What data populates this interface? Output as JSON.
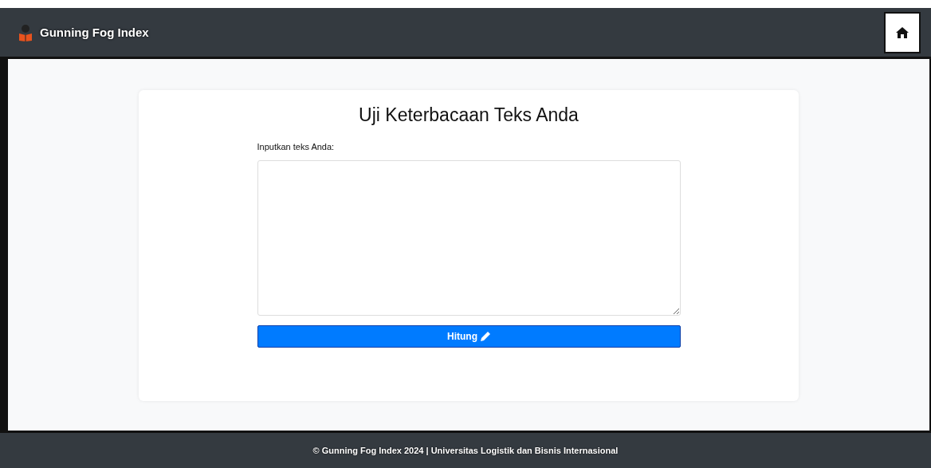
{
  "navbar": {
    "brand": "Gunning Fog Index"
  },
  "card": {
    "title": "Uji Keterbacaan Teks Anda",
    "label": "Inputkan teks Anda:",
    "button": "Hitung"
  },
  "footer": {
    "text": "© Gunning Fog Index 2024 | Universitas Logistik dan Bisnis Internasional"
  }
}
